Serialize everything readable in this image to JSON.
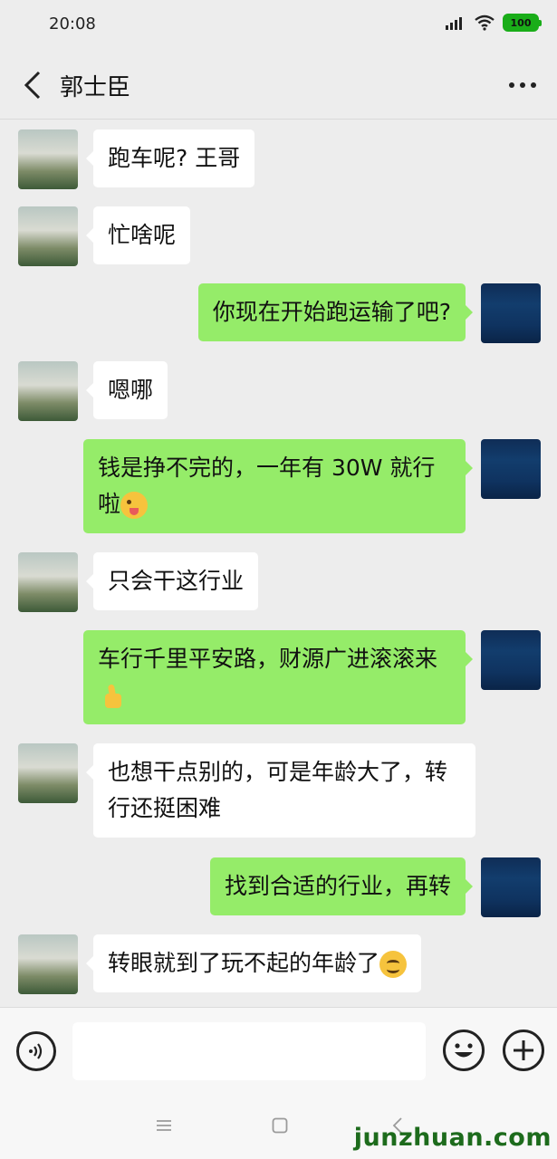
{
  "status_bar": {
    "time": "20:08",
    "battery": "100"
  },
  "header": {
    "title": "郭士臣"
  },
  "messages": [
    {
      "side": "in",
      "text": "跑车呢? 王哥"
    },
    {
      "side": "in",
      "text": "忙啥呢"
    },
    {
      "side": "out",
      "text": "你现在开始跑运输了吧?"
    },
    {
      "side": "in",
      "text": "嗯哪"
    },
    {
      "side": "out",
      "text": "钱是挣不完的，一年有 30W 就行",
      "text2": "啦",
      "emoji": "wink-face-emoji"
    },
    {
      "side": "in",
      "text": "只会干这行业"
    },
    {
      "side": "out",
      "text": "车行千里平安路，财源广进滚滚来",
      "emoji": "thumbs-up-emoji"
    },
    {
      "side": "in",
      "text": "也想干点别的，可是年龄大了，转",
      "text2": "行还挺困难"
    },
    {
      "side": "out",
      "text": "找到合适的行业，再转"
    },
    {
      "side": "in",
      "text": "转眼就到了玩不起的年龄了",
      "emoji": "smile-face-emoji"
    }
  ],
  "input_bar": {
    "placeholder": ""
  },
  "watermark": "junzhuan.com",
  "colors": {
    "outgoing_bubble": "#95ec69",
    "incoming_bubble": "#ffffff",
    "background": "#ededed"
  }
}
